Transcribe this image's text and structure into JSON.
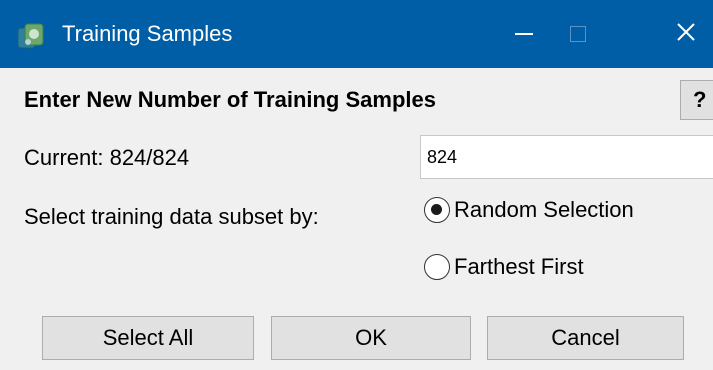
{
  "window": {
    "title": "Training Samples",
    "icon": "app-icon",
    "controls": {
      "minimize_icon": "minimize-icon",
      "maximize_icon": "maximize-icon",
      "close_glyph": "✕"
    },
    "colors": {
      "titlebar": "#005ea6",
      "background": "#f0f0f0"
    }
  },
  "dialog": {
    "heading": "Enter New Number of Training Samples",
    "help_label": "?",
    "current_label": "Current: 824/824",
    "samples_value": "824",
    "subset_label": "Select training data subset by:",
    "options": [
      {
        "label": "Random Selection",
        "checked": true
      },
      {
        "label": "Farthest First",
        "checked": false
      }
    ],
    "buttons": {
      "select_all": "Select All",
      "ok": "OK",
      "cancel": "Cancel"
    }
  }
}
